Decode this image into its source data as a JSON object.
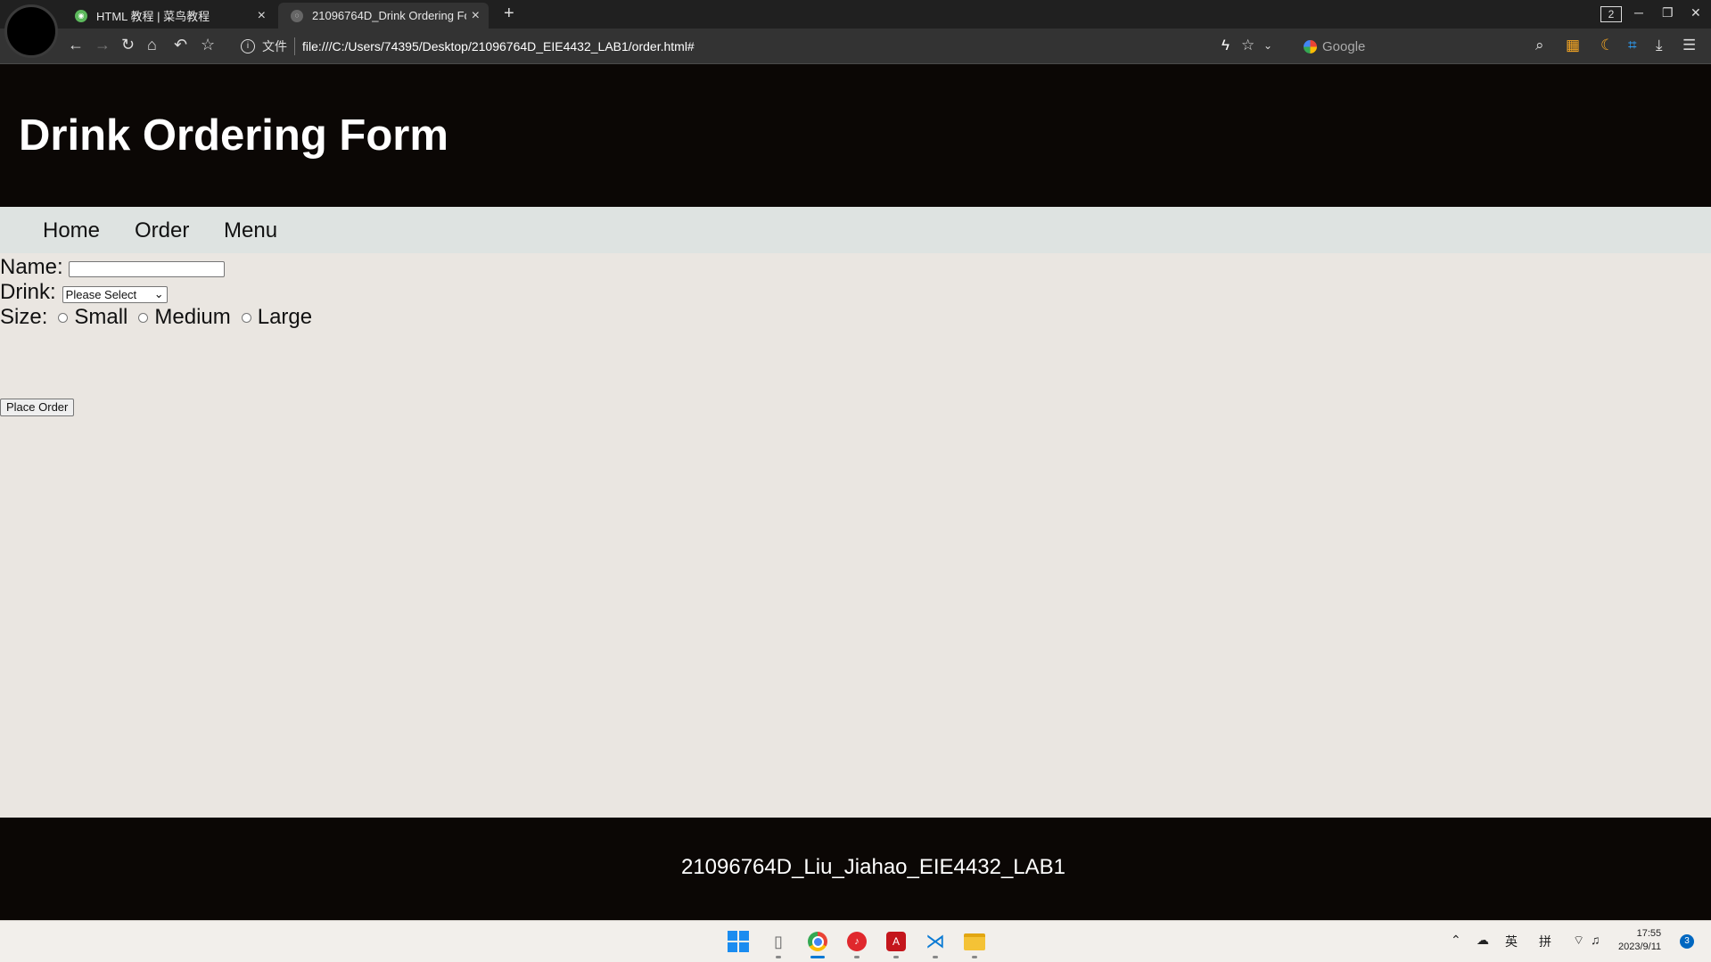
{
  "browser": {
    "tabs": [
      {
        "title": "HTML 教程 | 菜鸟教程",
        "close": "×"
      },
      {
        "title": "21096764D_Drink Ordering Fo",
        "close": "×"
      }
    ],
    "new_tab": "+",
    "window_count": "2",
    "url_scheme": "文件",
    "url": "file:///C:/Users/74395/Desktop/21096764D_EIE4432_LAB1/order.html#",
    "search_engine_placeholder": "Google",
    "window_controls": {
      "minimize": "─",
      "restore": "❐",
      "close": "✕"
    }
  },
  "page": {
    "title": "Drink Ordering Form",
    "nav": [
      "Home",
      "Order",
      "Menu"
    ],
    "form": {
      "name_label": "Name:",
      "name_value": "",
      "drink_label": "Drink:",
      "drink_selected": "Please Select",
      "size_label": "Size:",
      "sizes": [
        "Small",
        "Medium",
        "Large"
      ],
      "submit_label": "Place Order"
    },
    "footer": "21096764D_Liu_Jiahao_EIE4432_LAB1"
  },
  "taskbar": {
    "tray": {
      "ime_lang": "英",
      "ime_mode": "拼"
    },
    "time": "17:55",
    "date": "2023/9/11",
    "notifications": "3"
  },
  "colors": {
    "header_bg": "#0b0705",
    "nav_bg": "#dee3e1",
    "page_bg": "#eae6e1",
    "footer_bg": "#0b0705"
  }
}
